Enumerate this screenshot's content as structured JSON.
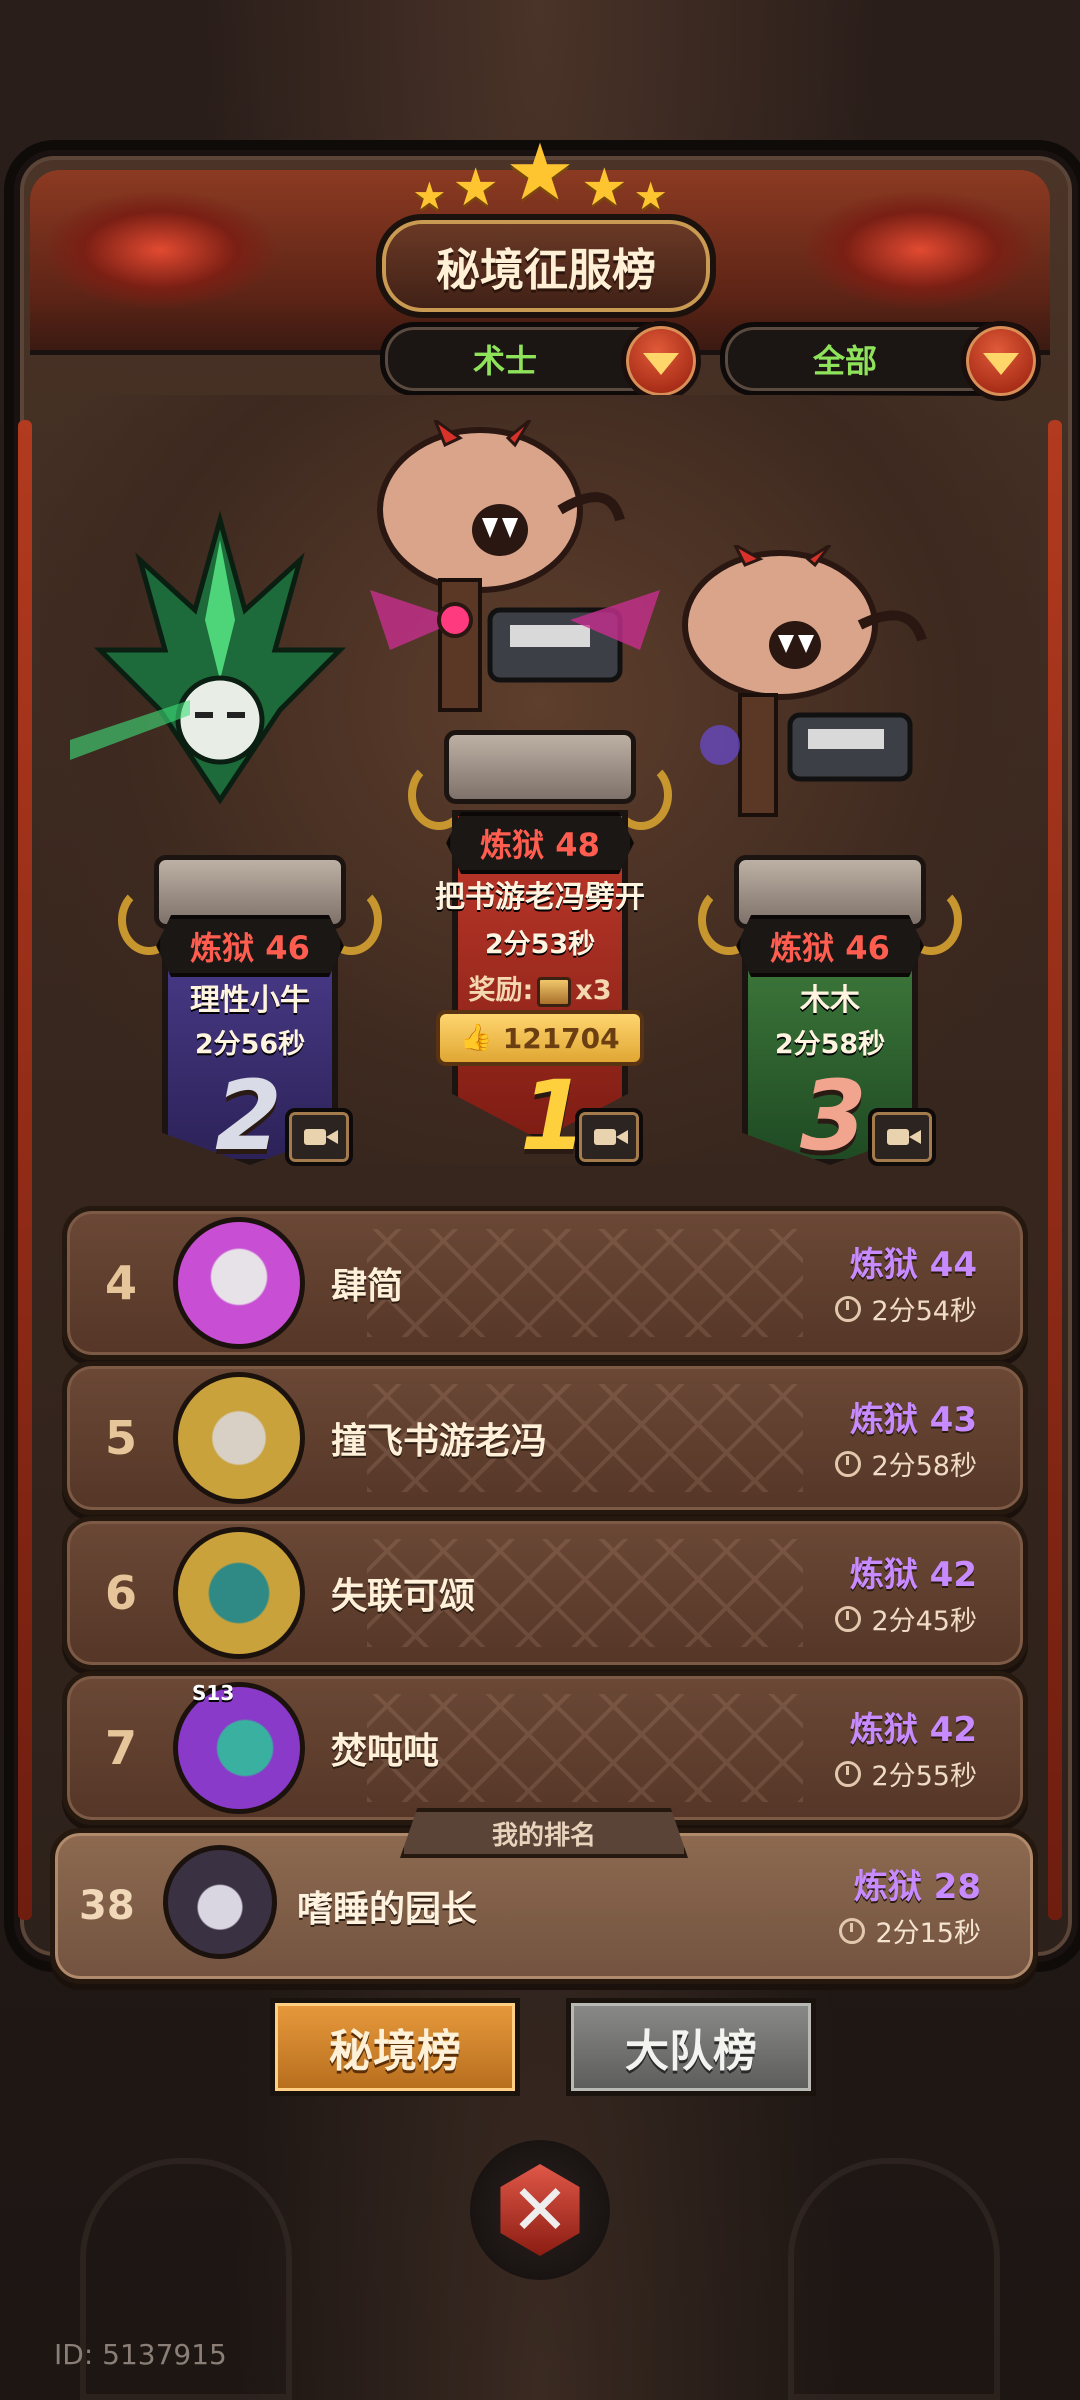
{
  "board": {
    "title": "秘境征服榜",
    "stars": [
      "star-icon",
      "star-icon",
      "star-icon",
      "star-icon",
      "star-icon"
    ],
    "class_filter": "术士",
    "scope_filter": "全部"
  },
  "podium": {
    "first": {
      "rank": "1",
      "level": "炼狱 48",
      "name": "把书游老冯劈开",
      "time": "2分53秒",
      "reward_label": "奖励:",
      "reward_count": "x3",
      "likes": "121704"
    },
    "second": {
      "rank": "2",
      "level": "炼狱 46",
      "name": "理性小牛",
      "time": "2分56秒"
    },
    "third": {
      "rank": "3",
      "level": "炼狱 46",
      "name": "木木",
      "time": "2分58秒"
    }
  },
  "rankings": [
    {
      "rank": "4",
      "name": "肆简",
      "level": "炼狱 44",
      "time": "2分54秒",
      "avatar_color": "#c84fd4"
    },
    {
      "rank": "5",
      "name": "撞飞书游老冯",
      "level": "炼狱 43",
      "time": "2分58秒",
      "avatar_color": "#c9a23c"
    },
    {
      "rank": "6",
      "name": "失联可颂",
      "level": "炼狱 42",
      "time": "2分45秒",
      "avatar_color": "#2f8a86"
    },
    {
      "rank": "7",
      "name": "焚吨吨",
      "level": "炼狱 42",
      "time": "2分55秒",
      "avatar_color": "#8a3ac9",
      "season_badge": "S13"
    }
  ],
  "my_rank": {
    "tag": "我的排名",
    "rank": "38",
    "name": "嗜睡的园长",
    "level": "炼狱 28",
    "time": "2分15秒"
  },
  "tabs": {
    "active": "秘境榜",
    "inactive": "大队榜"
  },
  "footer": {
    "user_id": "ID: 5137915"
  },
  "colors": {
    "level_red": "#ff5d4f",
    "level_purple": "#c78bff",
    "filter_green": "#8fe35a",
    "accent_orange": "#e89a3c"
  }
}
